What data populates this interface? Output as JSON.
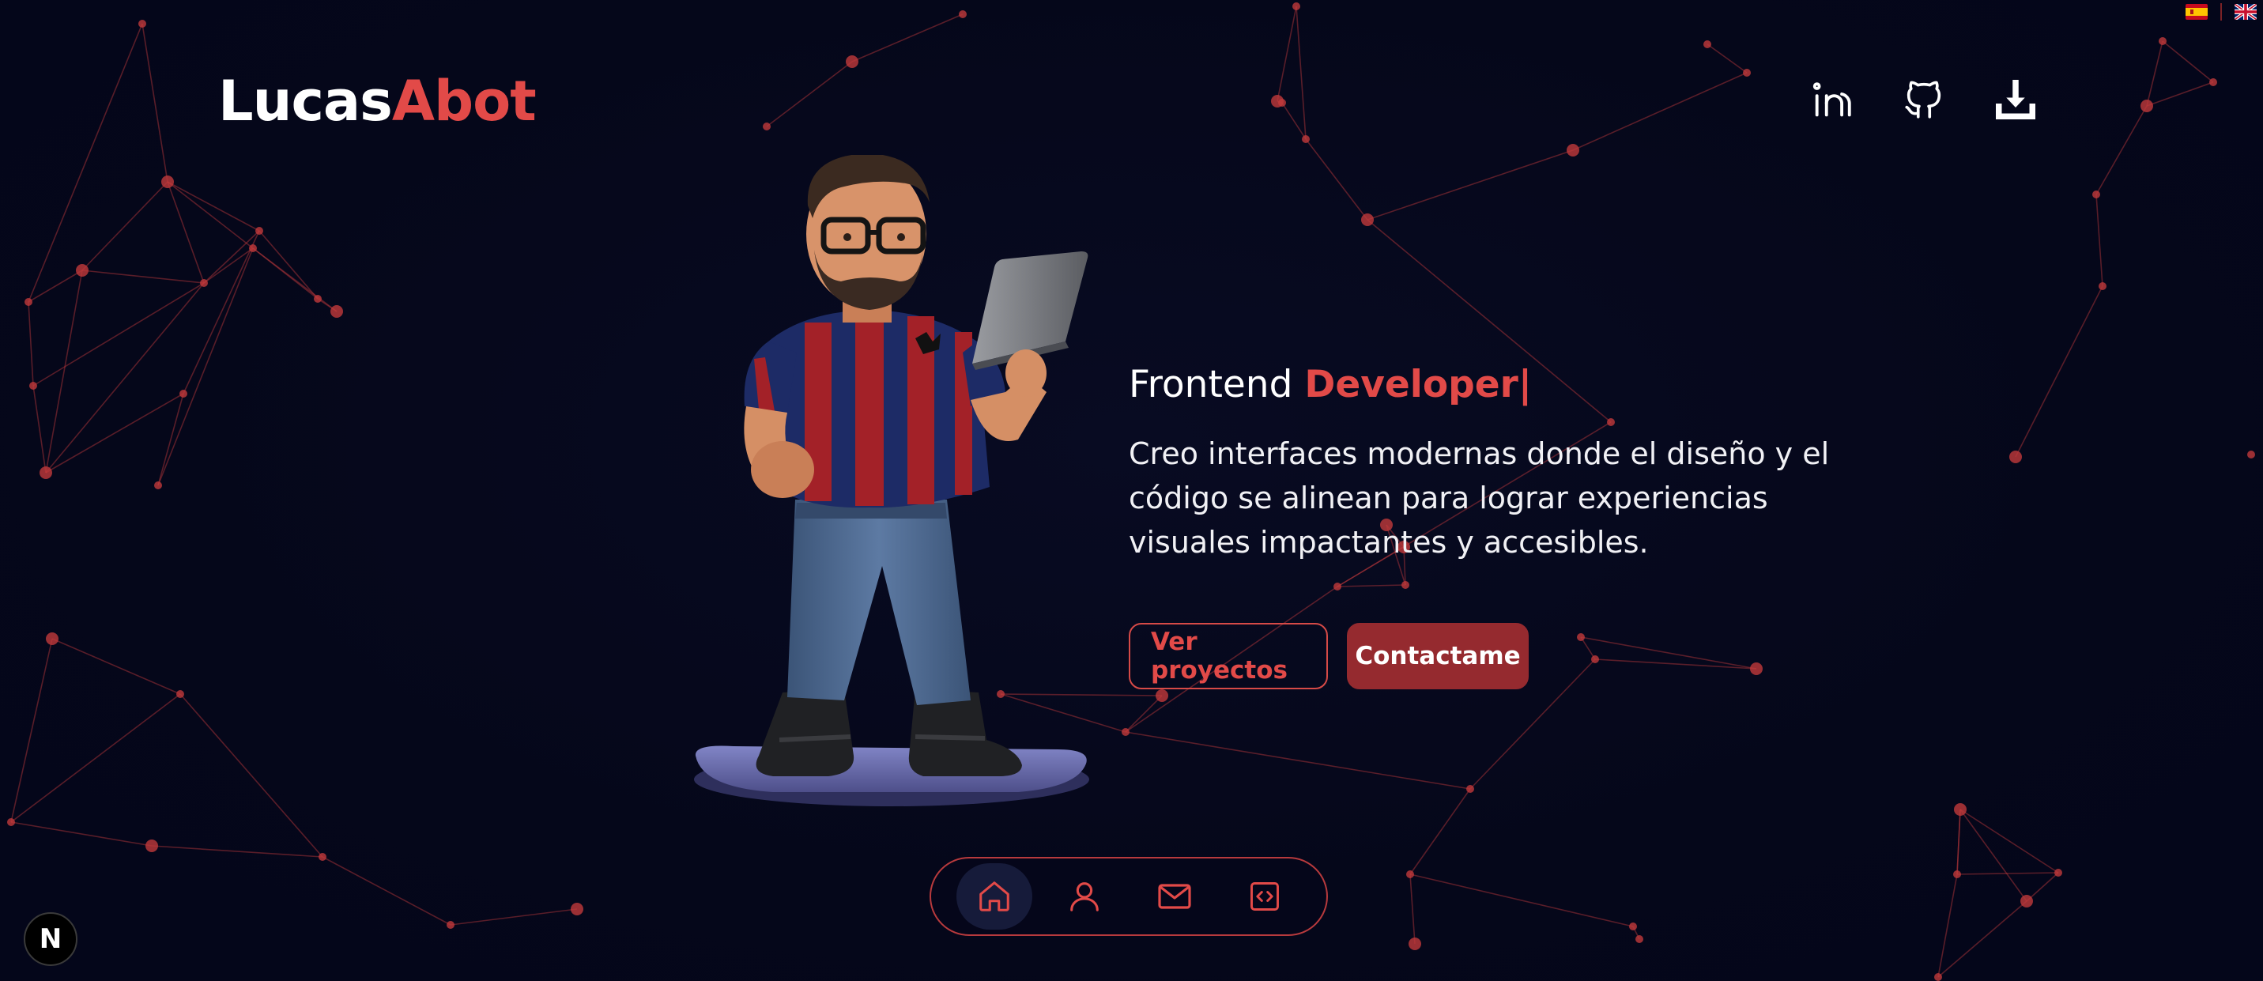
{
  "colors": {
    "background": "#05071a",
    "accent": "#e24a48",
    "button_solid": "#952a2f",
    "network": "#c0393b"
  },
  "header": {
    "logo_first": "Lucas",
    "logo_last": "Abot",
    "languages": [
      {
        "code": "es",
        "icon": "spain-flag-icon"
      },
      {
        "code": "en",
        "icon": "uk-flag-icon"
      }
    ],
    "social": [
      {
        "name": "linkedin",
        "icon": "linkedin-icon"
      },
      {
        "name": "github",
        "icon": "github-icon"
      },
      {
        "name": "download",
        "icon": "download-icon"
      }
    ]
  },
  "hero": {
    "role_prefix": "Frontend ",
    "role_accent": "Developer",
    "caret": "|",
    "description": "Creo interfaces modernas donde el diseño y el código se alinean para lograr experiencias visuales impactantes y accesibles.",
    "primary_button": "Ver proyectos",
    "secondary_button": "Contactame"
  },
  "dock": {
    "items": [
      {
        "name": "home",
        "icon": "home-icon",
        "active": true
      },
      {
        "name": "about",
        "icon": "user-icon",
        "active": false
      },
      {
        "name": "contact",
        "icon": "mail-icon",
        "active": false
      },
      {
        "name": "projects",
        "icon": "code-icon",
        "active": false
      }
    ]
  },
  "badge": {
    "label": "N"
  }
}
